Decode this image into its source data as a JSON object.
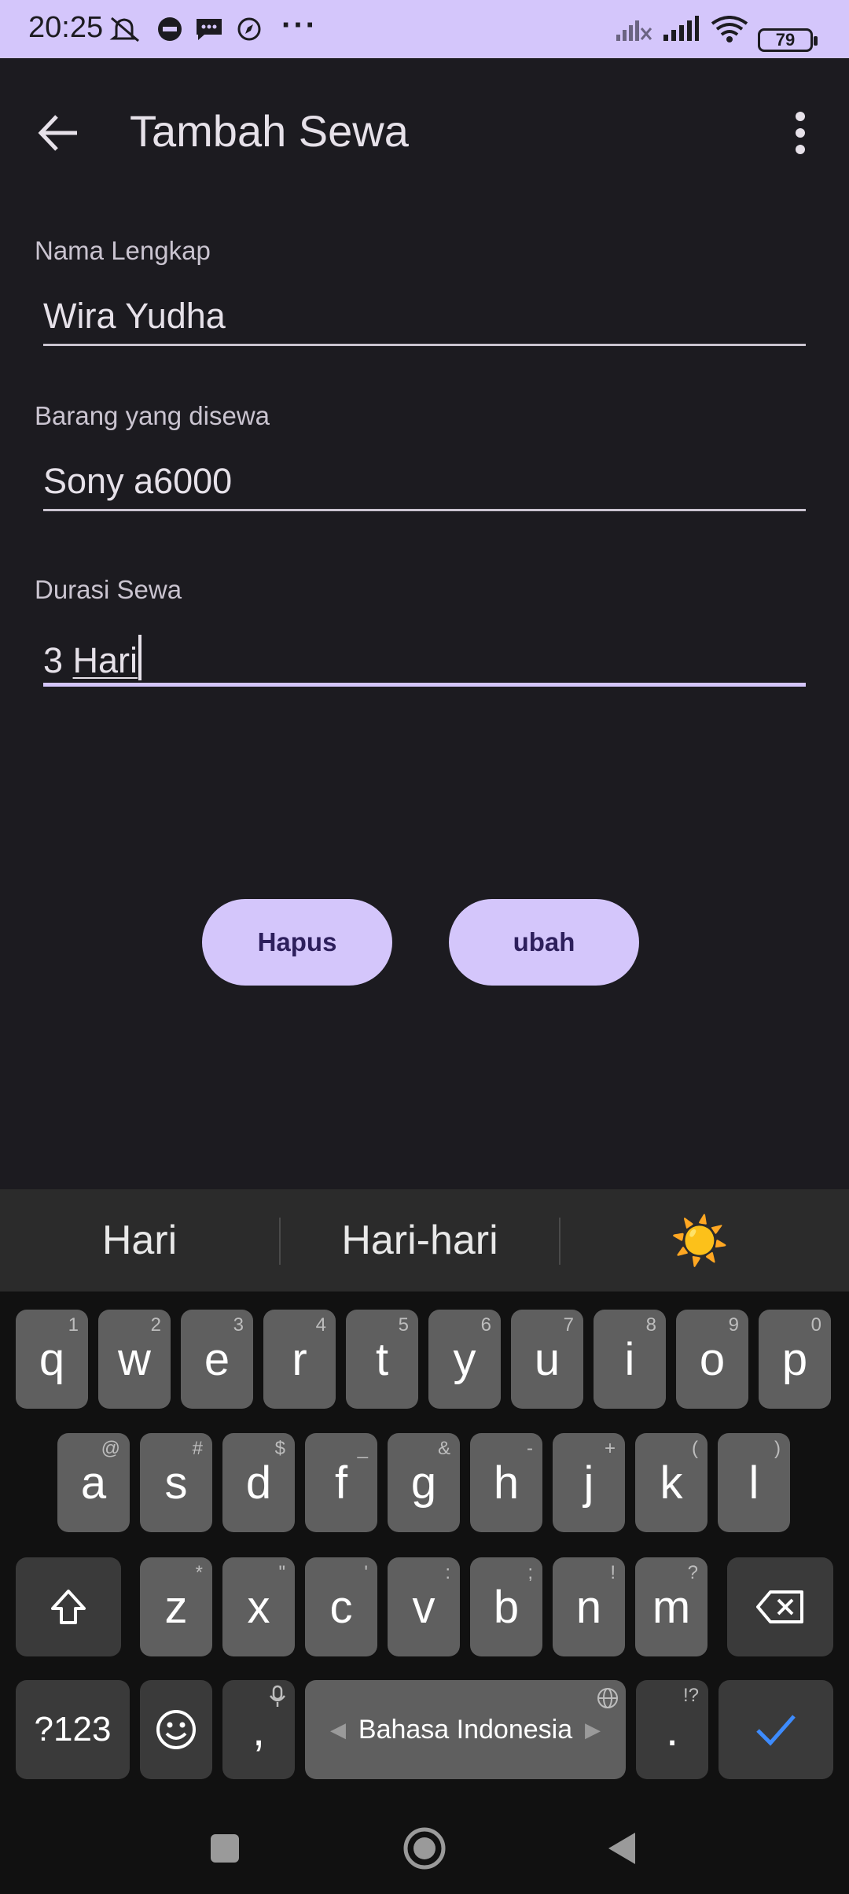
{
  "status_bar": {
    "time": "20:25",
    "battery": "79",
    "icons": [
      "mute-icon",
      "messenger-icon",
      "chat-icon",
      "compass-icon",
      "more-dots-icon",
      "signal-weak-icon",
      "signal-icon",
      "wifi-icon",
      "battery-icon"
    ],
    "more": "···"
  },
  "app_bar": {
    "title": "Tambah Sewa",
    "back_icon": "arrow-left-icon",
    "menu_icon": "more-vert-icon"
  },
  "form": {
    "name": {
      "label": "Nama Lengkap",
      "value": "Wira Yudha"
    },
    "item": {
      "label": "Barang yang disewa",
      "value": "Sony a6000"
    },
    "duration": {
      "label": "Durasi Sewa",
      "value_prefix": "3 ",
      "value_word": "Hari"
    }
  },
  "buttons": {
    "delete": "Hapus",
    "update": "ubah"
  },
  "keyboard": {
    "suggestions": [
      "Hari",
      "Hari-hari"
    ],
    "suggestion_emoji": "☀️",
    "row1": [
      {
        "k": "q",
        "h": "1"
      },
      {
        "k": "w",
        "h": "2"
      },
      {
        "k": "e",
        "h": "3"
      },
      {
        "k": "r",
        "h": "4"
      },
      {
        "k": "t",
        "h": "5"
      },
      {
        "k": "y",
        "h": "6"
      },
      {
        "k": "u",
        "h": "7"
      },
      {
        "k": "i",
        "h": "8"
      },
      {
        "k": "o",
        "h": "9"
      },
      {
        "k": "p",
        "h": "0"
      }
    ],
    "row2": [
      {
        "k": "a",
        "h": "@"
      },
      {
        "k": "s",
        "h": "#"
      },
      {
        "k": "d",
        "h": "$"
      },
      {
        "k": "f",
        "h": "_"
      },
      {
        "k": "g",
        "h": "&"
      },
      {
        "k": "h",
        "h": "-"
      },
      {
        "k": "j",
        "h": "+"
      },
      {
        "k": "k",
        "h": "("
      },
      {
        "k": "l",
        "h": ")"
      }
    ],
    "row3": [
      {
        "k": "z",
        "h": "*"
      },
      {
        "k": "x",
        "h": "\""
      },
      {
        "k": "c",
        "h": "'"
      },
      {
        "k": "v",
        "h": ":"
      },
      {
        "k": "b",
        "h": ";"
      },
      {
        "k": "n",
        "h": "!"
      },
      {
        "k": "m",
        "h": "?"
      }
    ],
    "symbols_key": "?123",
    "comma_key": ",",
    "space_label": "Bahasa Indonesia",
    "period_key": ".",
    "period_hint": "!?",
    "check_color": "#3d8bfd"
  },
  "colors": {
    "accent": "#d4c6fb",
    "background": "#1c1b20",
    "button_text": "#2d1f5c"
  }
}
